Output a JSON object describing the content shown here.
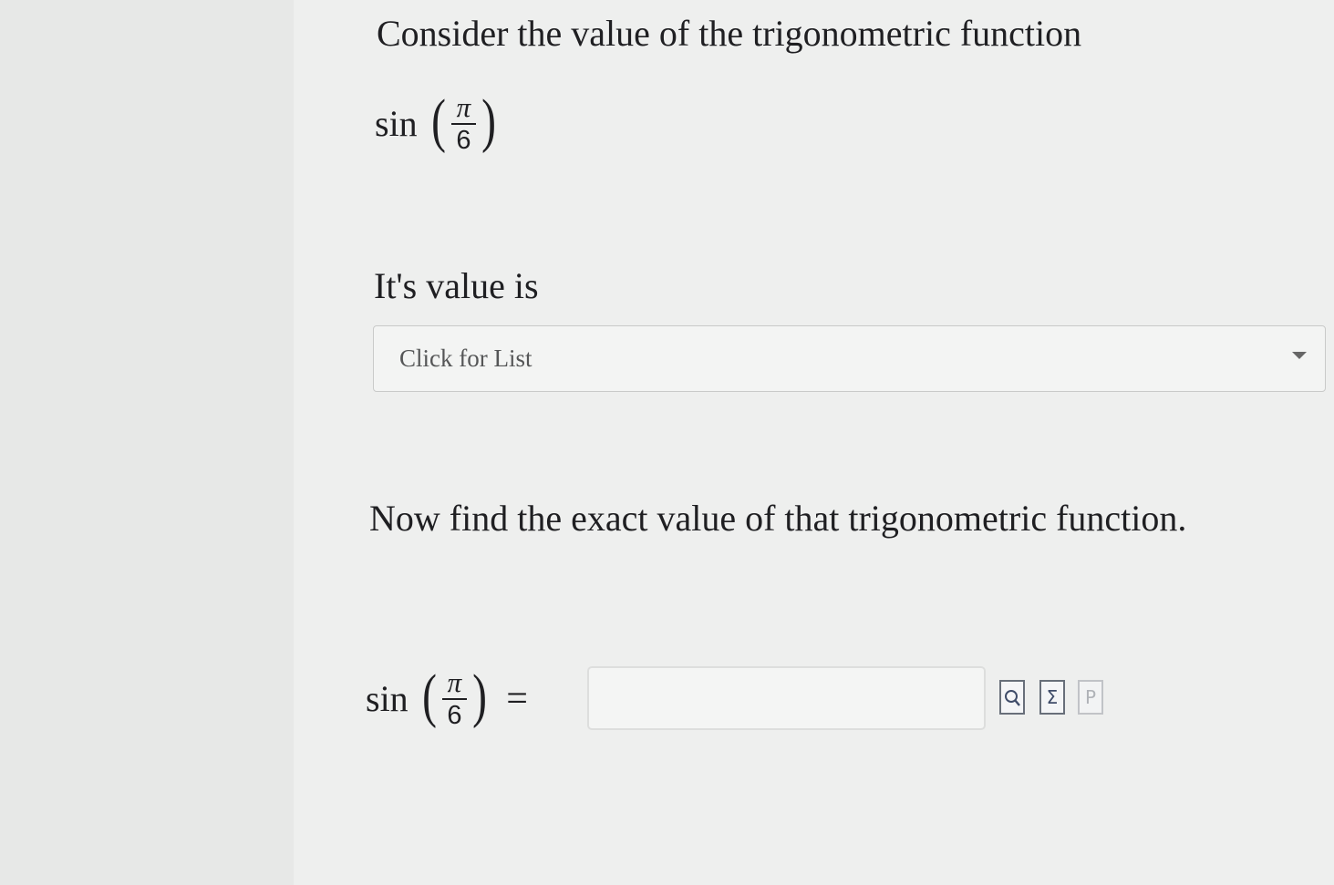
{
  "question": {
    "prompt_line": "Consider the value of the trigonometric function",
    "expression": {
      "function": "sin",
      "numerator": "π",
      "denominator": "6"
    },
    "value_prompt": "It's value is",
    "dropdown": {
      "selected": "Click for List"
    },
    "exact_prompt": "Now find the exact value of that trigonometric function.",
    "answer": {
      "function": "sin",
      "numerator": "π",
      "denominator": "6",
      "equals": "=",
      "value": ""
    }
  },
  "tools": [
    {
      "icon": "preview-icon"
    },
    {
      "icon": "sigma-icon",
      "glyph": "Σ"
    },
    {
      "icon": "p-icon",
      "glyph": "P"
    }
  ]
}
